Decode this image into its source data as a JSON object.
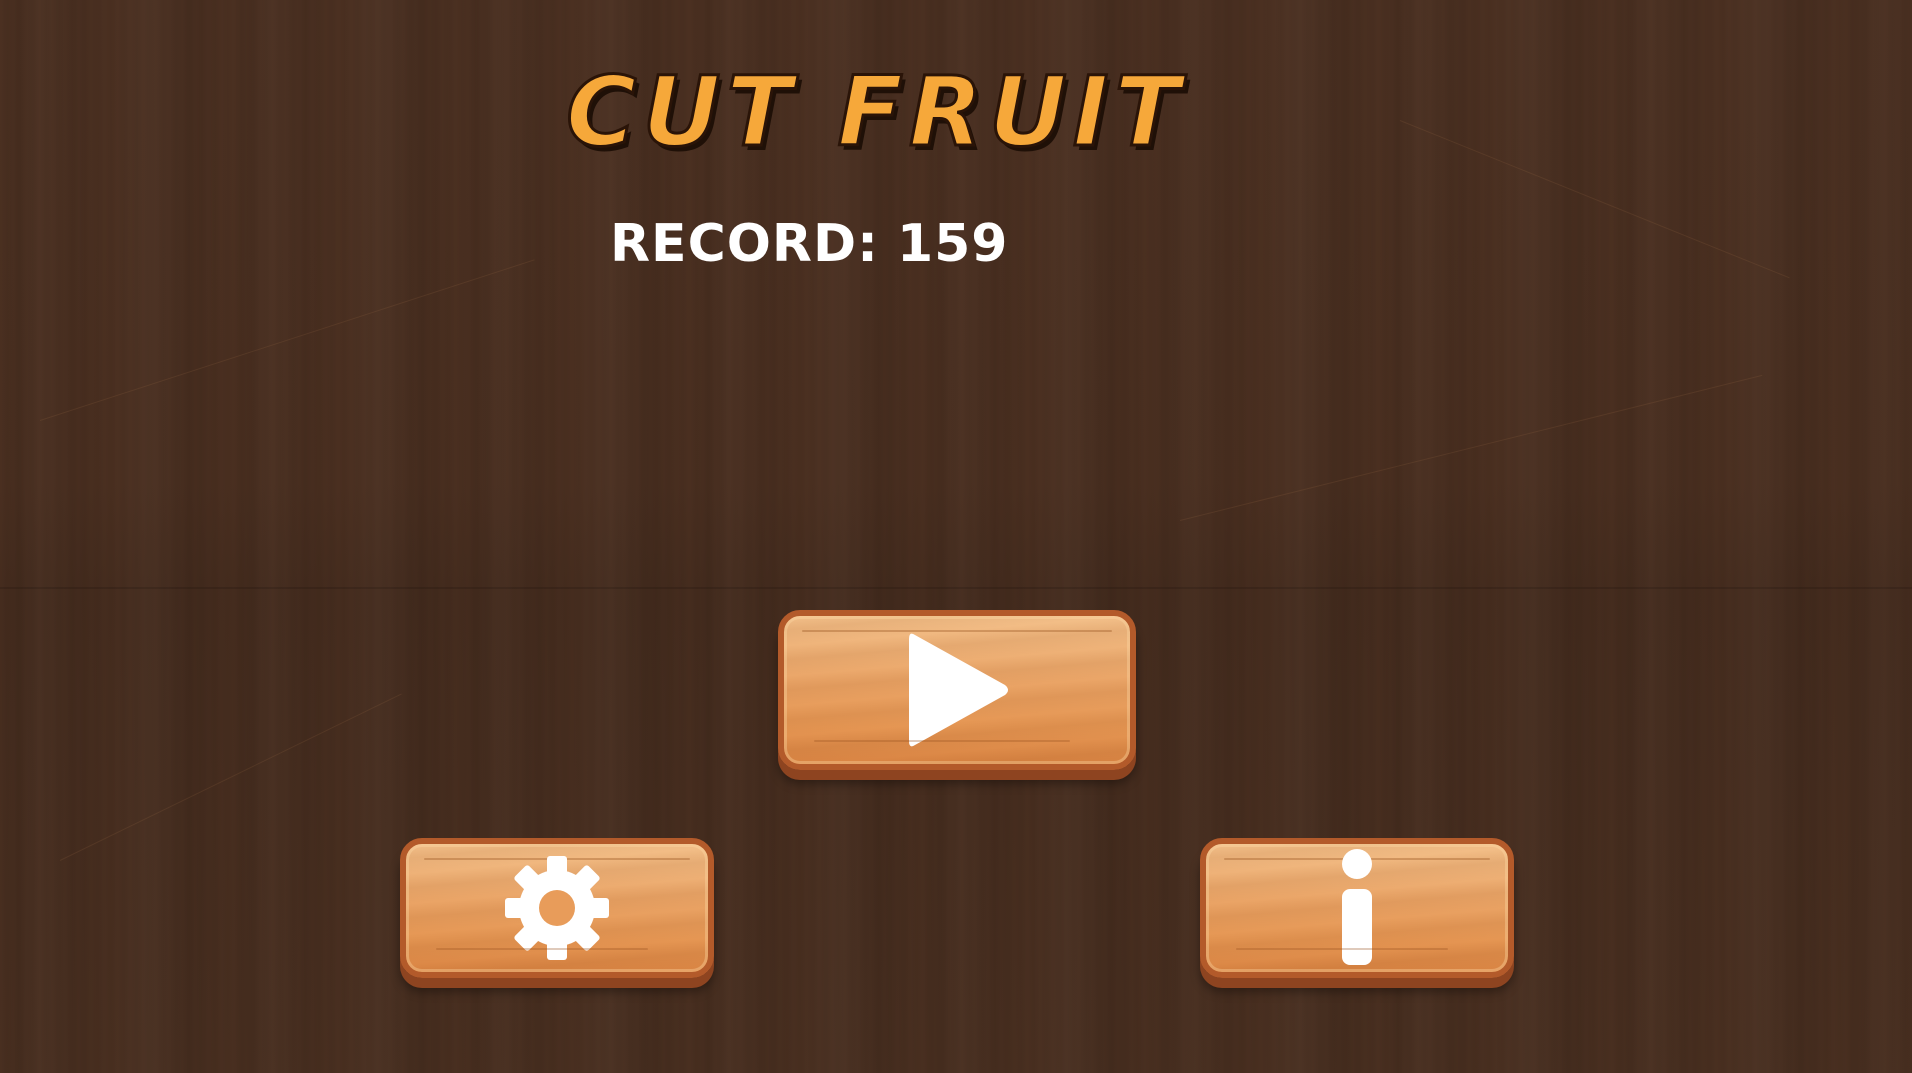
{
  "game": {
    "title": "Cut Fruit",
    "record_label": "RECORD:",
    "record_value": "159"
  },
  "buttons": {
    "play": {
      "icon": "play-icon"
    },
    "settings": {
      "icon": "gear-icon"
    },
    "info": {
      "icon": "info-icon"
    }
  },
  "colors": {
    "title": "#f6a83a",
    "background": "#4a2f20",
    "button_wood": "#eaa466",
    "button_border": "#b35a2a",
    "icon": "#ffffff"
  }
}
